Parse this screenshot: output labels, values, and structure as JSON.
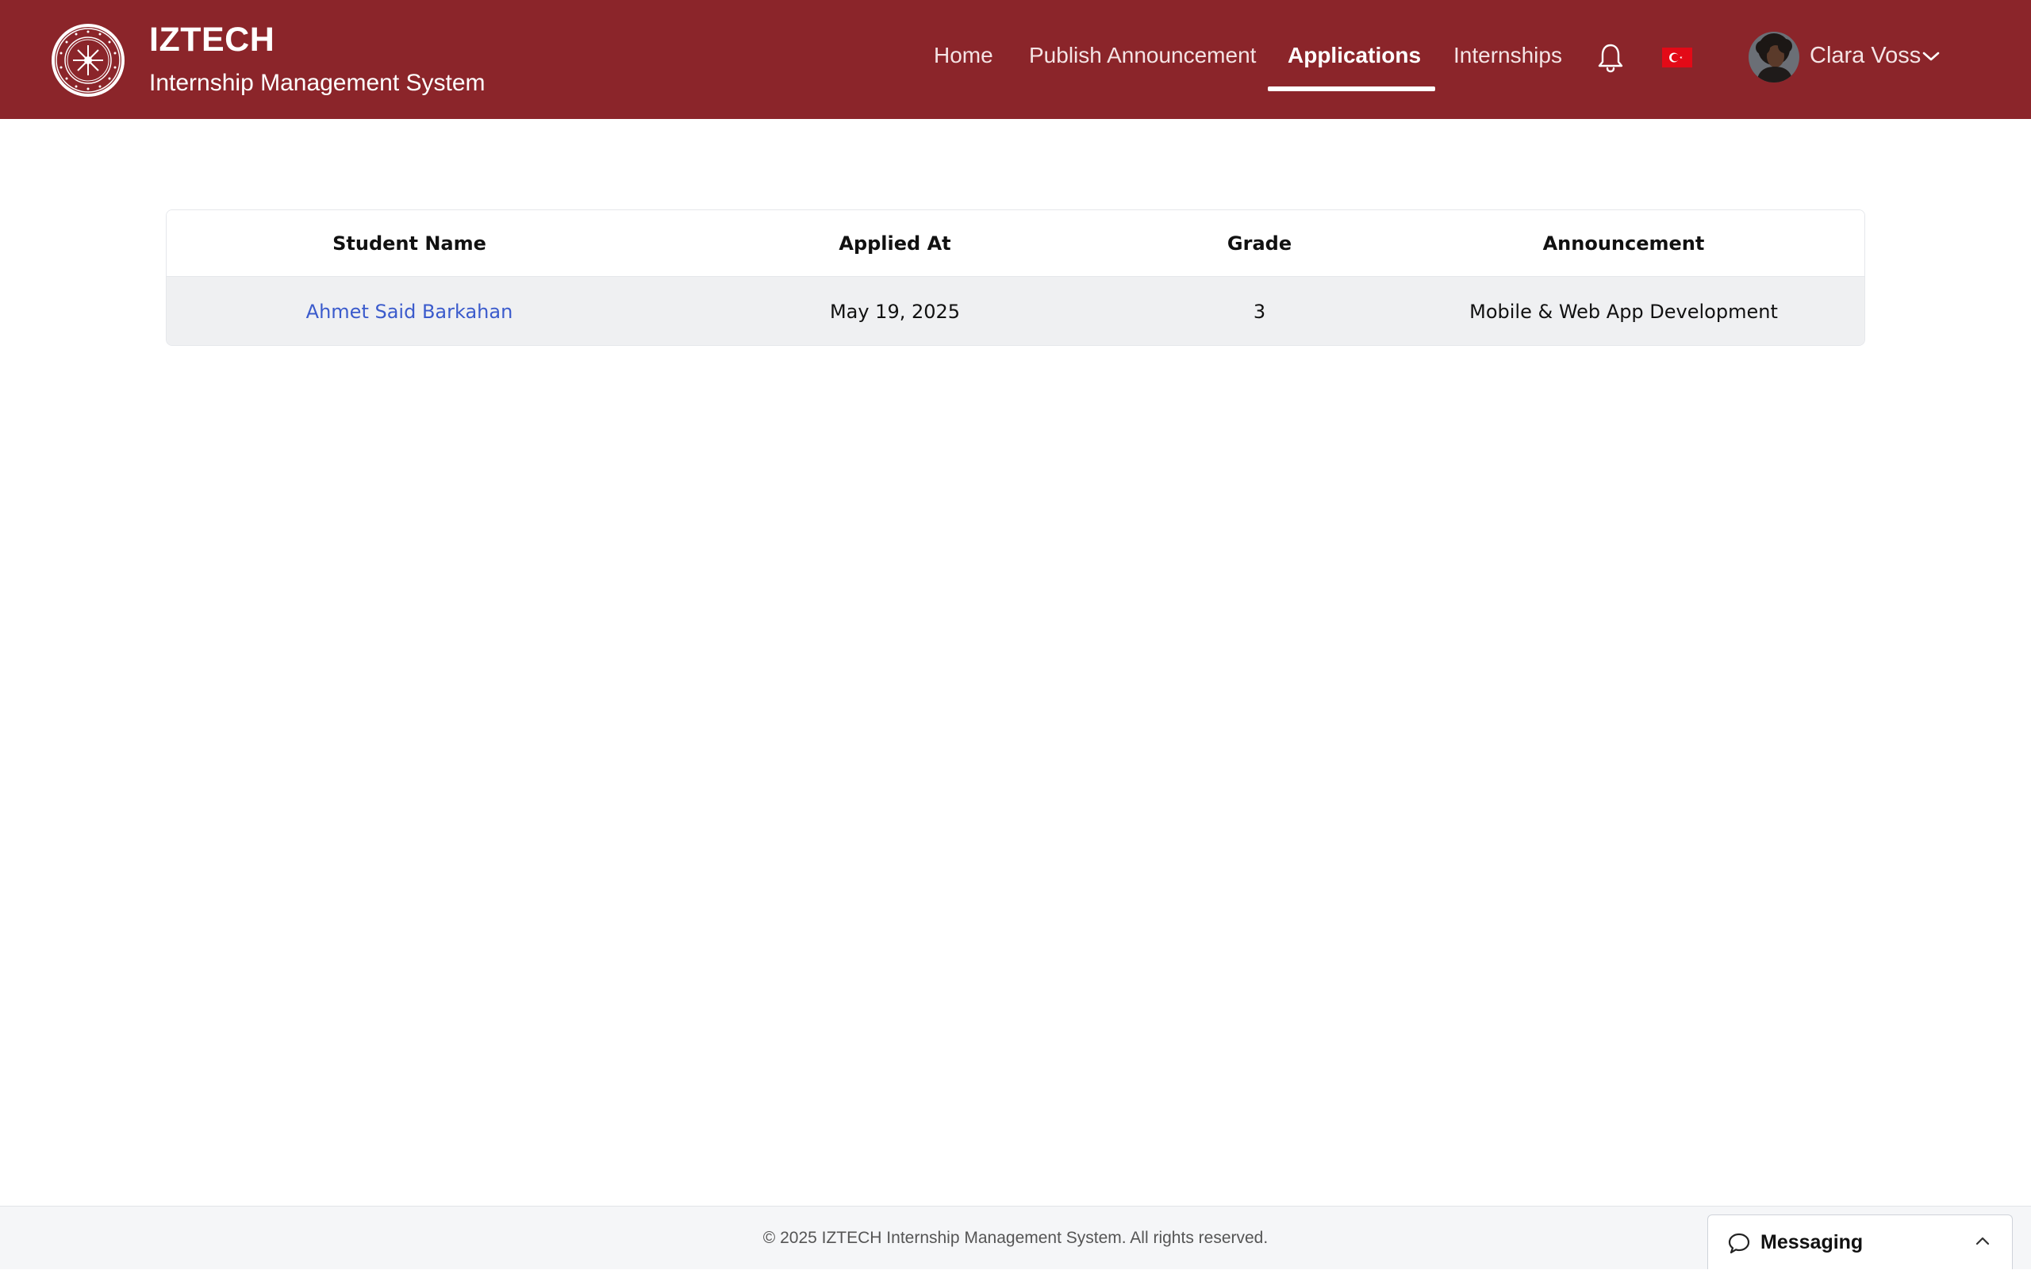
{
  "app": {
    "title": "IZTECH",
    "subtitle": "Internship Management System"
  },
  "nav": {
    "items": [
      {
        "label": "Home",
        "active": false
      },
      {
        "label": "Publish Announcement",
        "active": false
      },
      {
        "label": "Applications",
        "active": true
      },
      {
        "label": "Internships",
        "active": false
      }
    ],
    "notification_icon": "bell-icon",
    "language_icon": "turkey-flag-icon"
  },
  "user": {
    "name": "Clara Voss",
    "menu_icon": "chevron-down-icon"
  },
  "table": {
    "columns": [
      "Student Name",
      "Applied At",
      "Grade",
      "Announcement"
    ],
    "rows": [
      {
        "student_name": "Ahmet Said Barkahan",
        "applied_at": "May 19, 2025",
        "grade": "3",
        "announcement": "Mobile & Web App Development"
      }
    ]
  },
  "footer": {
    "copyright": "© 2025 IZTECH Internship Management System. All rights reserved."
  },
  "messaging": {
    "label": "Messaging",
    "icon": "chat-bubble-icon",
    "toggle_icon": "chevron-up-icon"
  },
  "colors": {
    "header_bg": "#8b252a",
    "link": "#3b5bcc",
    "row_bg": "#eff0f2"
  }
}
